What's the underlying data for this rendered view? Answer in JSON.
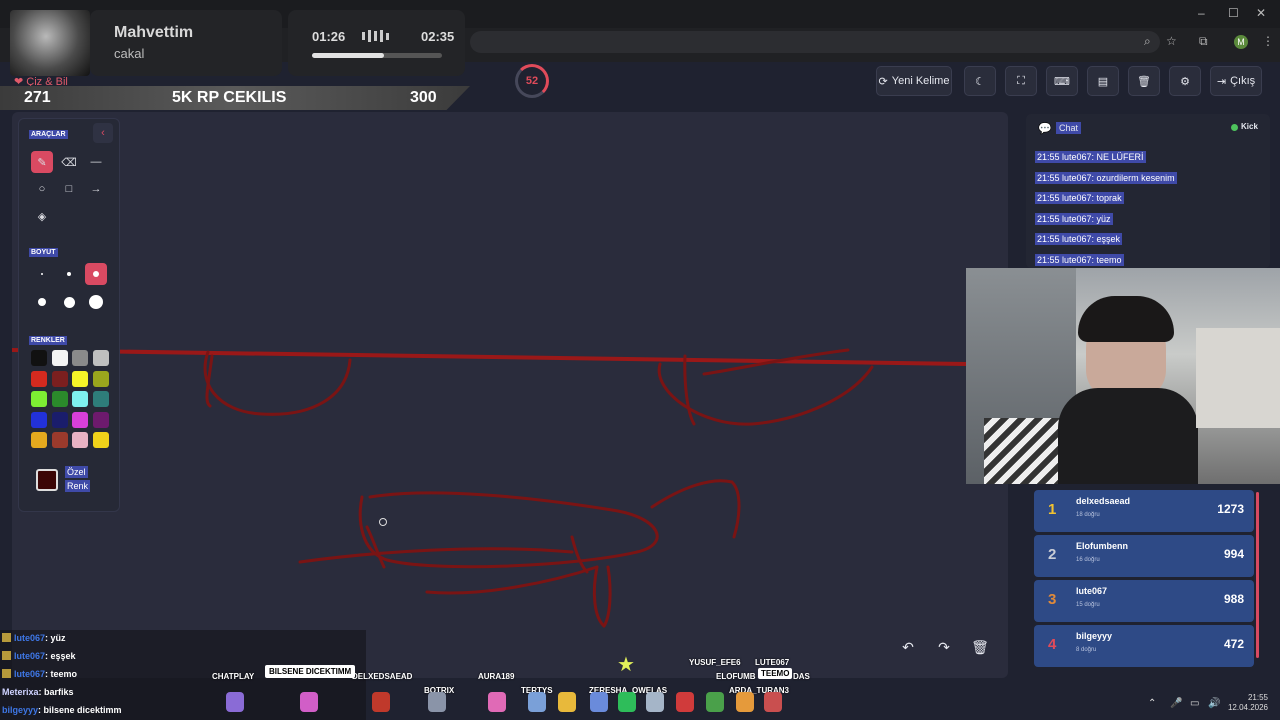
{
  "browser": {
    "win_buttons": {
      "minimize": "–",
      "maximize": "☐",
      "close": "✕"
    },
    "profile_initial": "M"
  },
  "music": {
    "title": "Mahvettim",
    "artist": "cakal",
    "current_time": "01:26",
    "total_time": "02:35",
    "progress": 0.55
  },
  "game": {
    "title": "Çiz & Bil",
    "banner": {
      "left": "271",
      "center": "5K RP CEKILIS",
      "right": "300"
    },
    "timer": "52"
  },
  "toolbar": {
    "new_word": "Yeni Kelime",
    "logout": "Çıkış"
  },
  "tools": {
    "tools_label": "ARAÇLAR",
    "size_label": "BOYUT",
    "colors_label": "RENKLER",
    "custom_color": "Özel Renk",
    "custom_color_line1": "Özel",
    "custom_color_line2": "Renk",
    "colors": [
      "#111111",
      "#f4f4f4",
      "#8a8a8a",
      "#bfbfbf",
      "#d42a1f",
      "#7b1f1f",
      "#f5f528",
      "#9aa61d",
      "#7ded33",
      "#2b8a2b",
      "#7ef0ef",
      "#2e7d7a",
      "#2231d9",
      "#1a1d6b",
      "#d83fd9",
      "#6d1a6d",
      "#e4a91e",
      "#9b3a2c",
      "#e8b2c4",
      "#f0d21a"
    ],
    "custom_swatch_color": "#3b0606"
  },
  "chat": {
    "title": "Chat",
    "platform": "Kick",
    "messages": [
      "21:55 lute067: NE LÜFERİ",
      "21:55 lute067: ozurdilerm kesenim",
      "21:55 lute067: toprak",
      "21:55 lute067: yüz",
      "21:55 lute067: eşşek",
      "21:55 lute067: teemo"
    ]
  },
  "leaderboard": [
    {
      "rank": "1",
      "name": "delxedsaead",
      "sub": "18 doğru",
      "score": "1273",
      "color": "#f2c230"
    },
    {
      "rank": "2",
      "name": "Elofumbenn",
      "sub": "16 doğru",
      "score": "994",
      "color": "#c9cdd6"
    },
    {
      "rank": "3",
      "name": "lute067",
      "sub": "15 doğru",
      "score": "988",
      "color": "#e08a3a"
    },
    {
      "rank": "4",
      "name": "bilgeyyy",
      "sub": "8 doğru",
      "score": "472",
      "color": "#e04b5a"
    }
  ],
  "stream_chat": [
    {
      "user": "lute067",
      "text": ": yüz"
    },
    {
      "user": "lute067",
      "text": ": eşşek"
    },
    {
      "user": "lute067",
      "text": ": teemo"
    },
    {
      "user": "Meterixa",
      "text": ": barfiks"
    },
    {
      "user": "bilgeyyy",
      "text": ": bilsene dicektimm"
    }
  ],
  "crowd": {
    "names": [
      "CHATPLAY",
      "DELXEDSAEAD",
      "BOTRIX",
      "AURA189",
      "TERTYS",
      "ZERESHA",
      "OWELAS",
      "YUSUF_EFE6",
      "LUTE067",
      "ELOFUMB",
      "DAS",
      "ARDA_TURAN3"
    ],
    "bubble_1": "BILSENE DICEKTIMM",
    "bubble_2": "TEEMO"
  },
  "system": {
    "time": "21:55",
    "date": "12.04.2026"
  }
}
